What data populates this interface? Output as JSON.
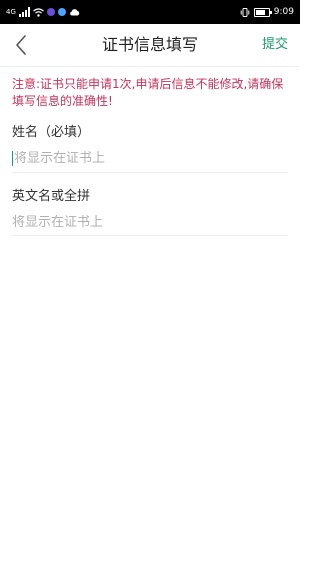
{
  "status_bar": {
    "time": "9:09",
    "network_label": "4G",
    "icons": [
      "signal-icon",
      "wifi-icon",
      "app-notification-icon",
      "cloud-icon",
      "vibrate-icon",
      "battery-icon"
    ]
  },
  "nav": {
    "title": "证书信息填写",
    "submit_label": "提交",
    "back_icon": "chevron-left-icon"
  },
  "notice": "注意:证书只能申请1次,申请后信息不能修改,请确保填写信息的准确性!",
  "form": {
    "fields": [
      {
        "label": "姓名（必填）",
        "placeholder": "将显示在证书上",
        "value": "",
        "focused": true
      },
      {
        "label": "英文名或全拼",
        "placeholder": "将显示在证书上",
        "value": "",
        "focused": false
      }
    ]
  },
  "colors": {
    "accent": "#1a9b6c",
    "notice": "#c8325a",
    "status_bar_bg": "#000000"
  }
}
